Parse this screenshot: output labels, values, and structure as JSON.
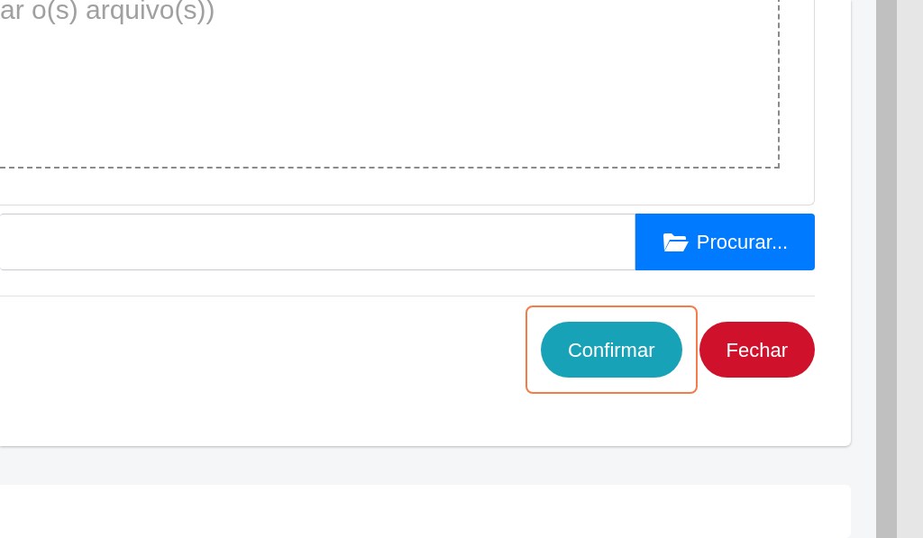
{
  "dropzone": {
    "hint": "ar o(s) arquivo(s))"
  },
  "file_input": {
    "button": "Procurar..."
  },
  "actions": [
    {
      "label": "Confirmar",
      "kind": "confirm",
      "highlighted": true
    },
    {
      "label": "Fechar",
      "kind": "close",
      "highlighted": false
    }
  ]
}
